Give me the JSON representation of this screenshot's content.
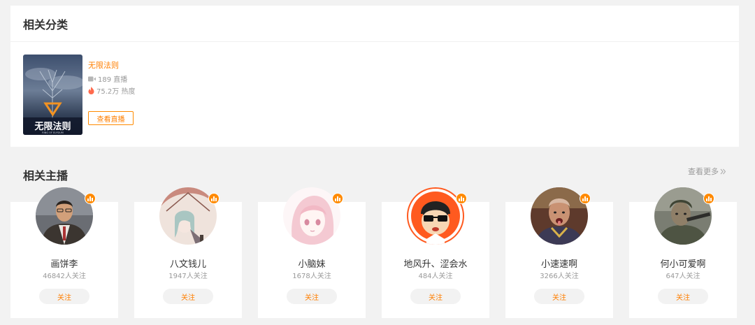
{
  "categories": {
    "title": "相关分类",
    "game": {
      "name": "无限法则",
      "cover_text": "无限法则",
      "cover_subtext": "RING OF ELYSIUM",
      "live_count": "189 直播",
      "heat": "75.2万 热度",
      "watch_label": "查看直播",
      "live_icon": "video-camera-icon",
      "heat_icon": "flame-icon"
    }
  },
  "streamers": {
    "title": "相关主播",
    "see_more": "查看更多",
    "follow_label": "关注",
    "items": [
      {
        "name": "画饼李",
        "followers": "46842人关注"
      },
      {
        "name": "八文钱儿",
        "followers": "1947人关注"
      },
      {
        "name": "小脑妹",
        "followers": "1678人关注"
      },
      {
        "name": "地风升、涩会水",
        "followers": "484人关注"
      },
      {
        "name": "小速速啊",
        "followers": "3266人关注"
      },
      {
        "name": "何小可爱啊",
        "followers": "647人关注"
      }
    ]
  },
  "colors": {
    "accent": "#ff7f00",
    "muted": "#999999",
    "background": "#f2f2f2"
  }
}
